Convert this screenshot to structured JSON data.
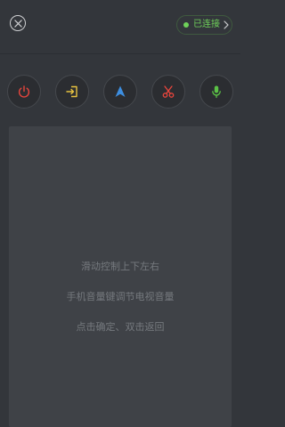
{
  "header": {
    "close_icon": "close-x-icon",
    "status": {
      "label": "已连接",
      "color": "#6fd15a",
      "border_color": "#3f5a3f",
      "icon": "chevron-right-icon"
    }
  },
  "controls": [
    {
      "id": "power",
      "icon": "power-icon",
      "color": "#e8453c"
    },
    {
      "id": "input",
      "icon": "input-source-icon",
      "color": "#e8c340"
    },
    {
      "id": "navigate",
      "icon": "navigation-arrow-icon",
      "color": "#3d8ee0"
    },
    {
      "id": "scissors",
      "icon": "scissors-icon",
      "color": "#e8453c"
    },
    {
      "id": "microphone",
      "icon": "microphone-icon",
      "color": "#5bc246"
    }
  ],
  "touchpad": {
    "hints": [
      "滑动控制上下左右",
      "手机音量键调节电视音量",
      "点击确定、双击返回"
    ],
    "hint_color": "#75797e"
  }
}
